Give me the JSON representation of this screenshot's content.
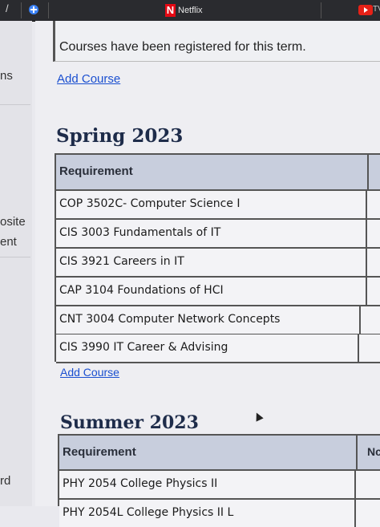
{
  "browser": {
    "tabs": [
      {
        "label": "Netflix",
        "icon": "netflix-icon"
      },
      {
        "label": "TV",
        "icon": "youtube-icon"
      }
    ]
  },
  "sidebar": {
    "fragments": [
      "ns",
      "osite",
      "ent",
      "rd"
    ]
  },
  "notice": "Courses have been registered for this term.",
  "links": {
    "add_course": "Add Course"
  },
  "terms": [
    {
      "title": "Spring 2023",
      "header": "Requirement",
      "rows": [
        "COP 3502C- Computer Science I",
        "CIS 3003 Fundamentals of IT",
        "CIS 3921 Careers in IT",
        "CAP 3104 Foundations of HCI",
        "CNT 3004 Computer Network Concepts",
        "CIS 3990 IT Career & Advising"
      ]
    },
    {
      "title": "Summer 2023",
      "header": "Requirement",
      "header2": "Nc",
      "rows": [
        "PHY 2054 College Physics II",
        "PHY 2054L College Physics II L"
      ]
    }
  ],
  "colors": {
    "link": "#1a4fd0",
    "term_title": "#1e2c4a",
    "table_header_bg": "#c8cedd"
  }
}
